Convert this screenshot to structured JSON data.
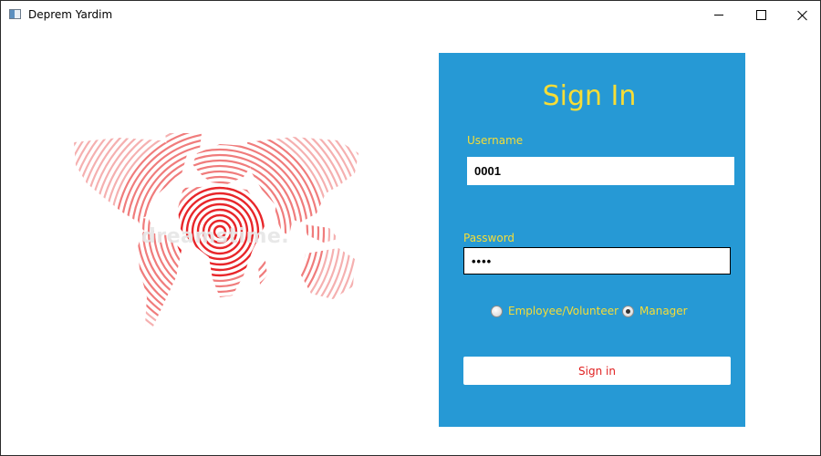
{
  "window": {
    "title": "Deprem Yardim",
    "icon": "app-window-icon"
  },
  "map": {
    "watermark": "dreamstime.",
    "colors": {
      "epicenter": "#e8262a",
      "rings": "#f28a8a"
    }
  },
  "form": {
    "title": "Sign In",
    "username_label": "Username",
    "username_value": "0001",
    "password_label": "Password",
    "password_value": "••••",
    "roles": [
      {
        "label": "Employee/Volunteer",
        "checked": false
      },
      {
        "label": "Manager",
        "checked": true
      }
    ],
    "signin_button": "Sign in"
  },
  "colors": {
    "panel": "#2699d5",
    "accent": "#f7dd36",
    "button_text": "#e02020"
  }
}
